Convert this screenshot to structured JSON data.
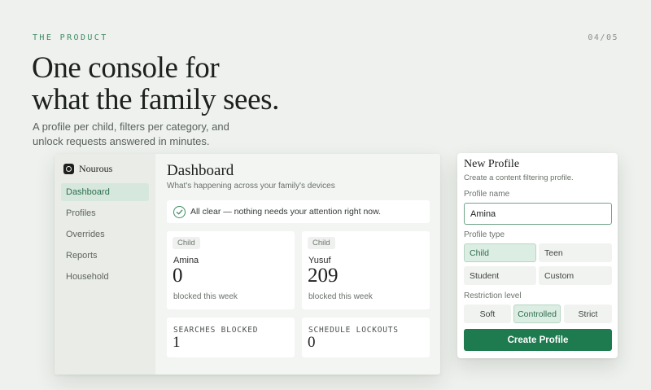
{
  "slide": {
    "eyebrow": "THE PRODUCT",
    "pager": "04/05",
    "headline_line1": "One console for",
    "headline_line2": "what the family sees.",
    "subline_line1": "A profile per child, filters per category, and",
    "subline_line2": "unlock requests answered in minutes."
  },
  "app": {
    "brand": "Nourous",
    "brand_icon": "nourous-logo-icon",
    "nav": [
      "Dashboard",
      "Profiles",
      "Overrides",
      "Reports",
      "Household"
    ],
    "active_nav": "Dashboard"
  },
  "dashboard": {
    "title": "Dashboard",
    "subtitle": "What's happening across your family's devices",
    "alert_icon": "check-circle-icon",
    "alert": "All clear — nothing needs your attention right now.",
    "profiles": [
      {
        "tag": "Child",
        "name": "Amina",
        "count": "0",
        "label": "blocked this week"
      },
      {
        "tag": "Child",
        "name": "Yusuf",
        "count": "209",
        "label": "blocked this week"
      }
    ],
    "stats": [
      {
        "label": "SEARCHES BLOCKED",
        "value": "1"
      },
      {
        "label": "SCHEDULE LOCKOUTS",
        "value": "0"
      }
    ]
  },
  "new_profile": {
    "title": "New Profile",
    "subtitle": "Create a content filtering profile.",
    "name_label": "Profile name",
    "name_value": "Amina",
    "type_label": "Profile type",
    "types": [
      "Child",
      "Teen",
      "Student",
      "Custom"
    ],
    "selected_type": "Child",
    "level_label": "Restriction level",
    "levels": [
      "Soft",
      "Controlled",
      "Strict"
    ],
    "selected_level": "Controlled",
    "submit": "Create Profile"
  },
  "colors": {
    "accent": "#1e7a4f",
    "accent_soft": "#dcede3",
    "background": "#eef1ed"
  }
}
